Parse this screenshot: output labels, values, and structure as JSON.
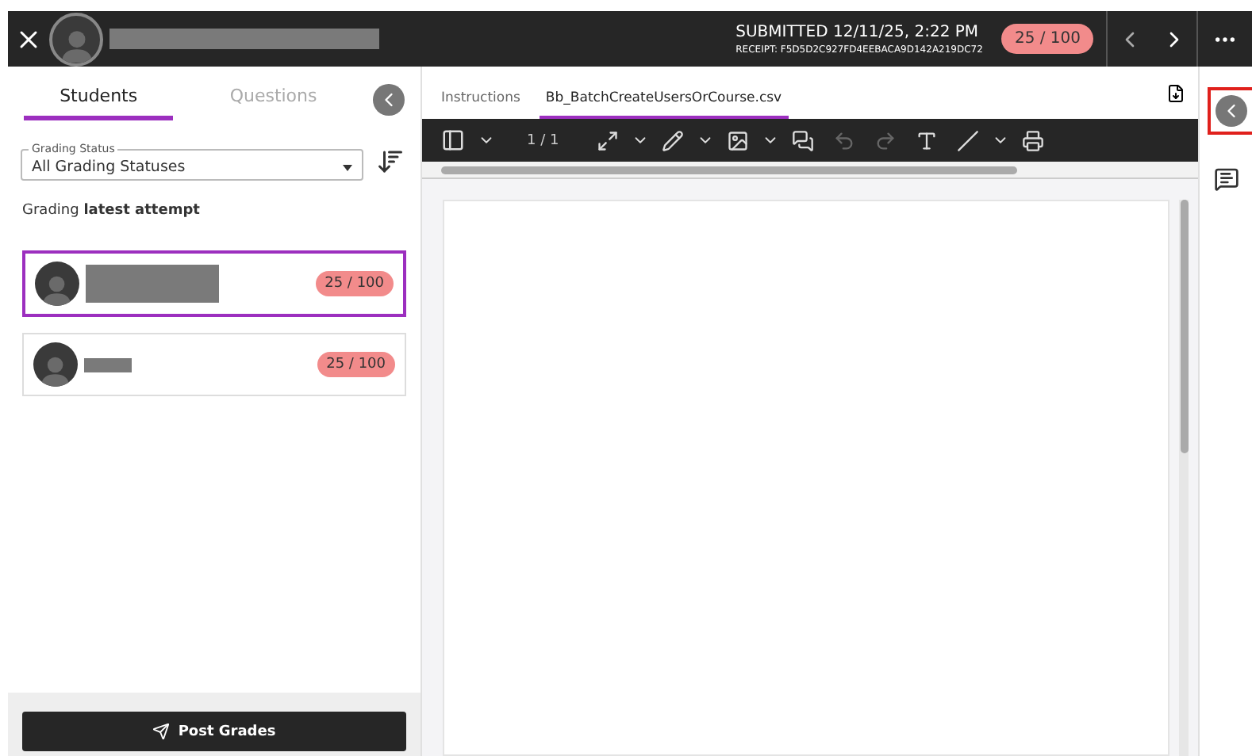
{
  "header": {
    "submitted": "SUBMITTED 12/11/25, 2:22 PM",
    "receipt": "RECEIPT: F5D5D2C927FD4EEBACA9D142A219DC72",
    "score": "25 / 100"
  },
  "panel_tabs": [
    {
      "label": "Students",
      "selected": true
    },
    {
      "label": "Questions",
      "selected": false
    }
  ],
  "grading_status": {
    "label": "Grading Status",
    "value": "All Grading Statuses"
  },
  "grading_note": "Grading **latest attempt**",
  "students": [
    {
      "score": "25 / 100",
      "selected": true
    },
    {
      "score": "25 / 100",
      "selected": false
    }
  ],
  "post_button": "Post Grades",
  "doc_tabs": [
    {
      "label": "Instructions",
      "selected": false
    },
    {
      "label": "Bb_BatchCreateUsersOrCourse.csv",
      "selected": true
    }
  ],
  "page_indicator": "1 / 1"
}
